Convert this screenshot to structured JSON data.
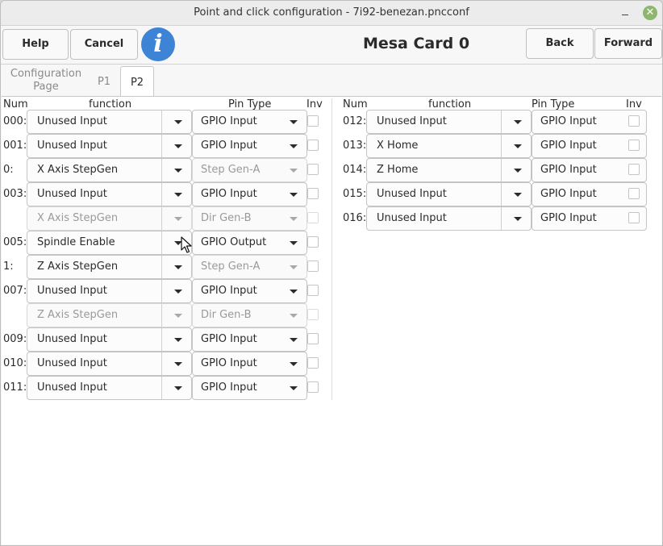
{
  "window": {
    "title": "Point and click configuration - 7i92-benezan.pncconf"
  },
  "toolbar": {
    "help": "Help",
    "cancel": "Cancel",
    "info_icon": "i",
    "page_title": "Mesa Card 0",
    "back": "Back",
    "forward": "Forward"
  },
  "tabs": {
    "config_line1": "Configuration",
    "config_line2": "Page",
    "p1": "P1",
    "p2": "P2",
    "active": "P2"
  },
  "headers": {
    "num": "Num",
    "function": "function",
    "pin_type": "Pin Type",
    "inv": "Inv"
  },
  "left_rows": [
    {
      "num": "000:",
      "function": "Unused Input",
      "pin_type": "GPIO Input",
      "enabled": true
    },
    {
      "num": "001:",
      "function": "Unused Input",
      "pin_type": "GPIO Input",
      "enabled": true
    },
    {
      "num": "0:",
      "function": "X Axis StepGen",
      "pin_type": "Step Gen-A",
      "enabled": true,
      "pin_type_enabled": false
    },
    {
      "num": "003:",
      "function": "Unused Input",
      "pin_type": "GPIO Input",
      "enabled": true
    },
    {
      "num": "",
      "function": "X Axis StepGen",
      "pin_type": "Dir Gen-B",
      "enabled": false
    },
    {
      "num": "005:",
      "function": "Spindle Enable",
      "pin_type": "GPIO Output",
      "enabled": true
    },
    {
      "num": "1:",
      "function": "Z Axis StepGen",
      "pin_type": "Step Gen-A",
      "enabled": true,
      "pin_type_enabled": false
    },
    {
      "num": "007:",
      "function": "Unused Input",
      "pin_type": "GPIO Input",
      "enabled": true
    },
    {
      "num": "",
      "function": "Z Axis StepGen",
      "pin_type": "Dir Gen-B",
      "enabled": false
    },
    {
      "num": "009:",
      "function": "Unused Input",
      "pin_type": "GPIO Input",
      "enabled": true
    },
    {
      "num": "010:",
      "function": "Unused Input",
      "pin_type": "GPIO Input",
      "enabled": true
    },
    {
      "num": "011:",
      "function": "Unused Input",
      "pin_type": "GPIO Input",
      "enabled": true
    }
  ],
  "right_rows": [
    {
      "num": "012:",
      "function": "Unused Input",
      "pin_type": "GPIO Input",
      "enabled": true
    },
    {
      "num": "013:",
      "function": "X Home",
      "pin_type": "GPIO Input",
      "enabled": true
    },
    {
      "num": "014:",
      "function": "Z Home",
      "pin_type": "GPIO Input",
      "enabled": true
    },
    {
      "num": "015:",
      "function": "Unused Input",
      "pin_type": "GPIO Input",
      "enabled": true
    },
    {
      "num": "016:",
      "function": "Unused Input",
      "pin_type": "GPIO Input",
      "enabled": true
    }
  ]
}
